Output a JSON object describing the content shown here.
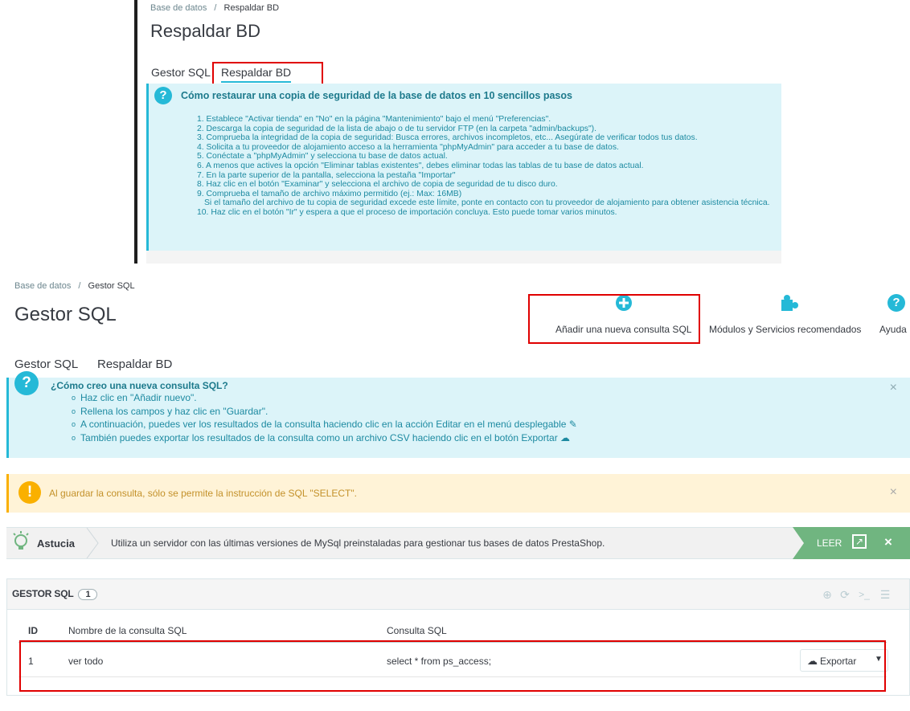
{
  "top": {
    "breadcrumb_parent": "Base de datos",
    "breadcrumb_sep": "/",
    "breadcrumb_current": "Respaldar BD",
    "title": "Respaldar BD",
    "tabs": [
      {
        "label": "Gestor SQL"
      },
      {
        "label": "Respaldar BD"
      }
    ],
    "help_title": "Cómo restaurar una copia de seguridad de la base de datos en 10 sencillos pasos",
    "steps": [
      "1. Establece \"Activar tienda\" en \"No\" en la página \"Mantenimiento\" bajo el menú \"Preferencias\".",
      "2. Descarga la copia de seguridad de la lista de abajo o de tu servidor FTP (en la carpeta \"admin/backups\").",
      "3. Comprueba la integridad de la copia de seguridad: Busca errores, archivos incompletos, etc... Asegúrate de verificar todos tus datos.",
      "4. Solicita a tu proveedor de alojamiento acceso a la herramienta \"phpMyAdmin\" para acceder a tu base de datos.",
      "5. Conéctate a \"phpMyAdmin\" y selecciona tu base de datos actual.",
      "6. A menos que actives la opción \"Eliminar tablas existentes\", debes eliminar todas las tablas de tu base de datos actual.",
      "7. En la parte superior de la pantalla, selecciona la pestaña \"Importar\"",
      "8. Haz clic en el botón \"Examinar\" y selecciona el archivo de copia de seguridad de tu disco duro.",
      "9. Comprueba el tamaño de archivo máximo permitido (ej.: Max: 16MB)",
      "   Si el tamaño del archivo de tu copia de seguridad excede este límite, ponte en contacto con tu proveedor de alojamiento para obtener asistencia técnica.",
      "10. Haz clic en el botón \"Ir\" y espera a que el proceso de importación concluya. Esto puede tomar varios minutos."
    ]
  },
  "bottom": {
    "breadcrumb_parent": "Base de datos",
    "breadcrumb_sep": "/",
    "breadcrumb_current": "Gestor SQL",
    "title": "Gestor SQL",
    "toolbar": {
      "add_label": "Añadir una nueva consulta SQL",
      "modules_label": "Módulos y Servicios recomendados",
      "help_label": "Ayuda"
    },
    "tabs": [
      {
        "label": "Gestor SQL"
      },
      {
        "label": "Respaldar BD"
      }
    ],
    "info_title": "¿Cómo creo una nueva consulta SQL?",
    "info_items": [
      "Haz clic en \"Añadir nuevo\".",
      "Rellena los campos y haz clic en \"Guardar\".",
      "A continuación, puedes ver los resultados de la consulta haciendo clic en la acción Editar en el menú desplegable",
      "También puedes exportar los resultados de la consulta como un archivo CSV haciendo clic en el botón Exportar"
    ],
    "close_symbol": "×",
    "warning_text": "Al guardar la consulta, sólo se permite la instrucción de SQL \"SELECT\".",
    "tip": {
      "label": "Astucia",
      "text": "Utiliza un servidor con las últimas versiones de MySql preinstaladas para gestionar tus bases de datos PrestaShop.",
      "read_label": "LEER"
    },
    "panel": {
      "title": "GESTOR SQL",
      "count": "1",
      "columns": [
        "ID",
        "Nombre de la consulta SQL",
        "Consulta SQL"
      ],
      "rows": [
        {
          "id": "1",
          "name": "ver todo",
          "query": "select * from ps_access;"
        }
      ],
      "export_label": "Exportar"
    },
    "colors": {
      "info_bg": "#dcf4f9",
      "accent": "#25b9d7",
      "warning_bg": "#fff3d7",
      "warning": "#fab000",
      "tip_green": "#70b580",
      "highlight": "#e00000"
    }
  }
}
